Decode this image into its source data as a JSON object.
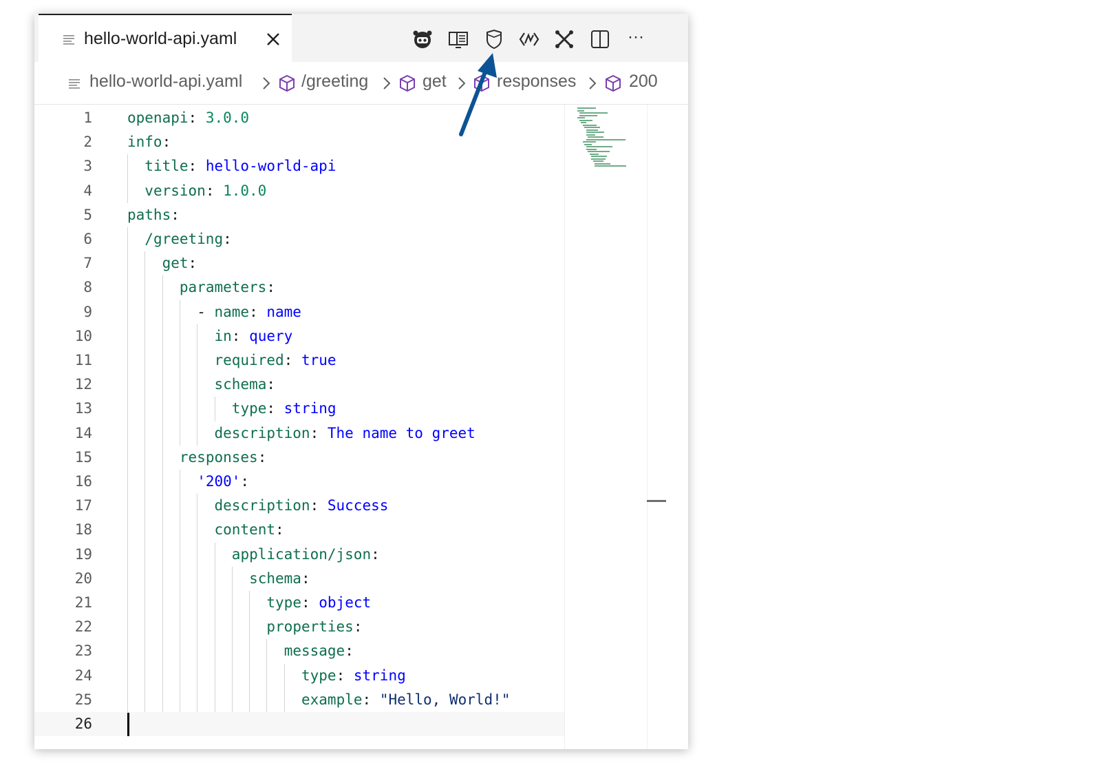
{
  "tab": {
    "title": "hello-world-api.yaml",
    "icons": [
      "file-lines-icon",
      "close-icon"
    ]
  },
  "toolbar": {
    "icons": [
      "api-bot-icon",
      "open-preview-icon",
      "shield-icon",
      "swagger-icon",
      "tools-icon",
      "split-editor-icon",
      "more-actions-icon"
    ],
    "more_label": "···"
  },
  "breadcrumb": {
    "file": "hello-world-api.yaml",
    "items": [
      "/greeting",
      "get",
      "responses",
      "200"
    ]
  },
  "editor": {
    "active_line": 26,
    "lines": [
      {
        "n": "1",
        "indent": 0,
        "parts": [
          {
            "t": "openapi",
            "c": "key"
          },
          {
            "t": ": ",
            "c": "punct"
          },
          {
            "t": "3.0.0",
            "c": "num"
          }
        ]
      },
      {
        "n": "2",
        "indent": 0,
        "parts": [
          {
            "t": "info",
            "c": "key"
          },
          {
            "t": ":",
            "c": "punct"
          }
        ]
      },
      {
        "n": "3",
        "indent": 1,
        "parts": [
          {
            "t": "title",
            "c": "key"
          },
          {
            "t": ": ",
            "c": "punct"
          },
          {
            "t": "hello-world-api",
            "c": "val"
          }
        ]
      },
      {
        "n": "4",
        "indent": 1,
        "parts": [
          {
            "t": "version",
            "c": "key"
          },
          {
            "t": ": ",
            "c": "punct"
          },
          {
            "t": "1.0.0",
            "c": "num"
          }
        ]
      },
      {
        "n": "5",
        "indent": 0,
        "parts": [
          {
            "t": "paths",
            "c": "key"
          },
          {
            "t": ":",
            "c": "punct"
          }
        ]
      },
      {
        "n": "6",
        "indent": 1,
        "parts": [
          {
            "t": "/greeting",
            "c": "key"
          },
          {
            "t": ":",
            "c": "punct"
          }
        ]
      },
      {
        "n": "7",
        "indent": 2,
        "parts": [
          {
            "t": "get",
            "c": "key"
          },
          {
            "t": ":",
            "c": "punct"
          }
        ]
      },
      {
        "n": "8",
        "indent": 3,
        "parts": [
          {
            "t": "parameters",
            "c": "key"
          },
          {
            "t": ":",
            "c": "punct"
          }
        ]
      },
      {
        "n": "9",
        "indent": 4,
        "parts": [
          {
            "t": "- ",
            "c": "punct"
          },
          {
            "t": "name",
            "c": "key"
          },
          {
            "t": ": ",
            "c": "punct"
          },
          {
            "t": "name",
            "c": "val"
          }
        ]
      },
      {
        "n": "10",
        "indent": 5,
        "parts": [
          {
            "t": "in",
            "c": "key"
          },
          {
            "t": ": ",
            "c": "punct"
          },
          {
            "t": "query",
            "c": "val"
          }
        ]
      },
      {
        "n": "11",
        "indent": 5,
        "parts": [
          {
            "t": "required",
            "c": "key"
          },
          {
            "t": ": ",
            "c": "punct"
          },
          {
            "t": "true",
            "c": "val"
          }
        ]
      },
      {
        "n": "12",
        "indent": 5,
        "parts": [
          {
            "t": "schema",
            "c": "key"
          },
          {
            "t": ":",
            "c": "punct"
          }
        ]
      },
      {
        "n": "13",
        "indent": 6,
        "parts": [
          {
            "t": "type",
            "c": "key"
          },
          {
            "t": ": ",
            "c": "punct"
          },
          {
            "t": "string",
            "c": "val"
          }
        ]
      },
      {
        "n": "14",
        "indent": 5,
        "parts": [
          {
            "t": "description",
            "c": "key"
          },
          {
            "t": ": ",
            "c": "punct"
          },
          {
            "t": "The name to greet",
            "c": "val"
          }
        ]
      },
      {
        "n": "15",
        "indent": 3,
        "parts": [
          {
            "t": "responses",
            "c": "key"
          },
          {
            "t": ":",
            "c": "punct"
          }
        ]
      },
      {
        "n": "16",
        "indent": 4,
        "parts": [
          {
            "t": "'200'",
            "c": "val"
          },
          {
            "t": ":",
            "c": "punct"
          }
        ]
      },
      {
        "n": "17",
        "indent": 5,
        "parts": [
          {
            "t": "description",
            "c": "key"
          },
          {
            "t": ": ",
            "c": "punct"
          },
          {
            "t": "Success",
            "c": "val"
          }
        ]
      },
      {
        "n": "18",
        "indent": 5,
        "parts": [
          {
            "t": "content",
            "c": "key"
          },
          {
            "t": ":",
            "c": "punct"
          }
        ]
      },
      {
        "n": "19",
        "indent": 6,
        "parts": [
          {
            "t": "application/json",
            "c": "key"
          },
          {
            "t": ":",
            "c": "punct"
          }
        ]
      },
      {
        "n": "20",
        "indent": 7,
        "parts": [
          {
            "t": "schema",
            "c": "key"
          },
          {
            "t": ":",
            "c": "punct"
          }
        ]
      },
      {
        "n": "21",
        "indent": 8,
        "parts": [
          {
            "t": "type",
            "c": "key"
          },
          {
            "t": ": ",
            "c": "punct"
          },
          {
            "t": "object",
            "c": "val"
          }
        ]
      },
      {
        "n": "22",
        "indent": 8,
        "parts": [
          {
            "t": "properties",
            "c": "key"
          },
          {
            "t": ":",
            "c": "punct"
          }
        ]
      },
      {
        "n": "23",
        "indent": 9,
        "parts": [
          {
            "t": "message",
            "c": "key"
          },
          {
            "t": ":",
            "c": "punct"
          }
        ]
      },
      {
        "n": "24",
        "indent": 10,
        "parts": [
          {
            "t": "type",
            "c": "key"
          },
          {
            "t": ": ",
            "c": "punct"
          },
          {
            "t": "string",
            "c": "val"
          }
        ]
      },
      {
        "n": "25",
        "indent": 10,
        "parts": [
          {
            "t": "example",
            "c": "key"
          },
          {
            "t": ": ",
            "c": "punct"
          },
          {
            "t": "\"Hello, World!\"",
            "c": "str"
          }
        ]
      },
      {
        "n": "26",
        "indent": 0,
        "parts": []
      }
    ]
  },
  "colors": {
    "key": "#0e6e4f",
    "value": "#0000ff",
    "number": "#098658",
    "string": "#0f2e6e",
    "arrow": "#0b5394"
  }
}
